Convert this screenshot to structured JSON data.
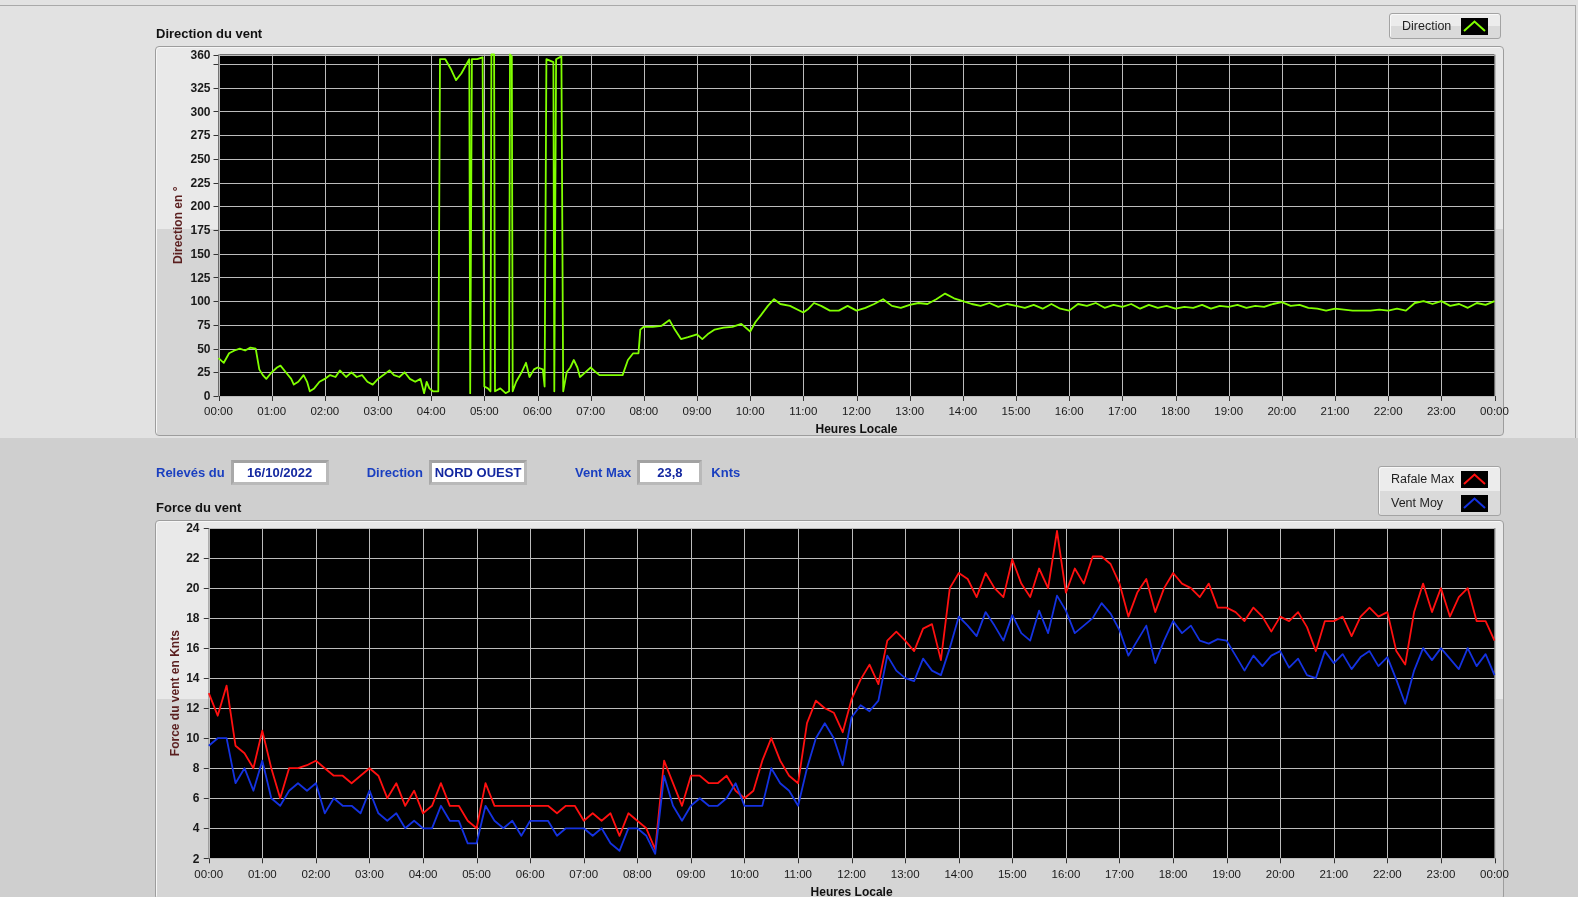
{
  "direction_chart": {
    "axis_end_label": "00:00",
    "chart_data": {
      "type": "line",
      "title": "Direction du vent",
      "xlabel": "Heures Locale",
      "ylabel": "Direction en °",
      "grid": true,
      "xlim": [
        0,
        1440
      ],
      "ylim": [
        0,
        360
      ],
      "xticks": [
        {
          "value": 0,
          "label": "00:00"
        },
        {
          "value": 60,
          "label": "01:00"
        },
        {
          "value": 120,
          "label": "02:00"
        },
        {
          "value": 180,
          "label": "03:00"
        },
        {
          "value": 240,
          "label": "04:00"
        },
        {
          "value": 300,
          "label": "05:00"
        },
        {
          "value": 360,
          "label": "06:00"
        },
        {
          "value": 420,
          "label": "07:00"
        },
        {
          "value": 480,
          "label": "08:00"
        },
        {
          "value": 540,
          "label": "09:00"
        },
        {
          "value": 600,
          "label": "10:00"
        },
        {
          "value": 660,
          "label": "11:00"
        },
        {
          "value": 720,
          "label": "12:00"
        },
        {
          "value": 780,
          "label": "13:00"
        },
        {
          "value": 840,
          "label": "14:00"
        },
        {
          "value": 900,
          "label": "15:00"
        },
        {
          "value": 960,
          "label": "16:00"
        },
        {
          "value": 1020,
          "label": "17:00"
        },
        {
          "value": 1080,
          "label": "18:00"
        },
        {
          "value": 1140,
          "label": "19:00"
        },
        {
          "value": 1200,
          "label": "20:00"
        },
        {
          "value": 1260,
          "label": "21:00"
        },
        {
          "value": 1320,
          "label": "22:00"
        },
        {
          "value": 1380,
          "label": "23:00"
        }
      ],
      "yticks": [
        0,
        25,
        50,
        75,
        100,
        125,
        150,
        175,
        200,
        225,
        250,
        275,
        300,
        325,
        360
      ],
      "x": [
        0,
        6,
        12,
        18,
        24,
        30,
        36,
        42,
        46,
        50,
        54,
        60,
        66,
        70,
        76,
        82,
        85,
        90,
        96,
        100,
        103,
        108,
        114,
        120,
        126,
        132,
        137,
        144,
        150,
        156,
        162,
        168,
        174,
        180,
        186,
        193,
        198,
        204,
        210,
        216,
        222,
        228,
        232,
        235,
        238,
        242,
        248,
        250,
        256,
        262,
        268,
        274,
        280,
        283,
        284,
        286,
        292,
        298,
        300,
        304,
        307,
        308,
        311,
        312,
        318,
        324,
        328,
        329,
        331,
        332,
        336,
        342,
        347,
        351,
        356,
        360,
        366,
        368,
        370,
        378,
        379,
        381,
        387,
        389,
        393,
        397,
        401,
        405,
        408,
        414,
        420,
        426,
        430,
        440,
        450,
        456,
        462,
        468,
        474,
        476,
        480,
        490,
        500,
        509,
        515,
        522,
        530,
        540,
        546,
        552,
        560,
        570,
        580,
        590,
        600,
        606,
        612,
        620,
        627,
        634,
        645,
        660,
        666,
        672,
        680,
        690,
        700,
        710,
        720,
        730,
        740,
        750,
        760,
        770,
        780,
        790,
        800,
        810,
        820,
        830,
        840,
        850,
        860,
        870,
        880,
        890,
        900,
        910,
        920,
        930,
        940,
        950,
        960,
        970,
        980,
        990,
        1000,
        1010,
        1020,
        1030,
        1040,
        1050,
        1060,
        1070,
        1080,
        1090,
        1100,
        1110,
        1120,
        1130,
        1140,
        1150,
        1160,
        1170,
        1180,
        1190,
        1200,
        1210,
        1220,
        1230,
        1240,
        1250,
        1260,
        1270,
        1280,
        1290,
        1300,
        1310,
        1320,
        1330,
        1340,
        1350,
        1360,
        1370,
        1380,
        1390,
        1400,
        1410,
        1420,
        1430,
        1440
      ],
      "series": [
        {
          "name": "Direction",
          "color": "#80ff00",
          "values": [
            40,
            35,
            45,
            48,
            50,
            48,
            51,
            50,
            28,
            22,
            18,
            25,
            30,
            32,
            25,
            18,
            12,
            15,
            22,
            15,
            5,
            8,
            15,
            18,
            22,
            20,
            27,
            20,
            25,
            20,
            22,
            15,
            12,
            18,
            22,
            27,
            22,
            20,
            25,
            18,
            15,
            18,
            3,
            15,
            8,
            5,
            5,
            355,
            355,
            345,
            333,
            340,
            350,
            355,
            3,
            355,
            355,
            357,
            10,
            8,
            5,
            360,
            360,
            5,
            8,
            3,
            5,
            360,
            358,
            5,
            15,
            25,
            35,
            20,
            28,
            30,
            28,
            10,
            355,
            352,
            5,
            355,
            358,
            5,
            25,
            30,
            38,
            30,
            20,
            25,
            30,
            25,
            22,
            22,
            22,
            22,
            38,
            45,
            45,
            70,
            73,
            73,
            74,
            80,
            70,
            60,
            62,
            65,
            60,
            65,
            70,
            72,
            73,
            76,
            68,
            78,
            85,
            95,
            102,
            97,
            95,
            88,
            92,
            98,
            95,
            90,
            90,
            95,
            90,
            93,
            97,
            102,
            95,
            93,
            96,
            98,
            97,
            102,
            108,
            103,
            100,
            97,
            95,
            98,
            94,
            97,
            95,
            93,
            96,
            92,
            97,
            92,
            90,
            97,
            95,
            98,
            93,
            96,
            94,
            97,
            92,
            96,
            93,
            95,
            92,
            94,
            93,
            96,
            92,
            95,
            94,
            96,
            93,
            95,
            94,
            97,
            99,
            95,
            96,
            93,
            92,
            90,
            92,
            91,
            90,
            90,
            90,
            91,
            90,
            92,
            90,
            98,
            100,
            97,
            100,
            95,
            97,
            93,
            98,
            96,
            100
          ]
        }
      ]
    }
  },
  "readings": [
    {
      "label": "Relevés du",
      "value": "16/10/2022"
    },
    {
      "label": "Direction",
      "value": "NORD OUEST"
    },
    {
      "label": "Vent Max",
      "value": "23,8",
      "unit": "Knts"
    }
  ],
  "force_chart": {
    "axis_end_label": "00:00",
    "chart_data": {
      "type": "line",
      "title": "Force du vent",
      "xlabel": "Heures Locale",
      "ylabel": "Force du vent en Knts",
      "grid": true,
      "xlim": [
        0,
        1440
      ],
      "ylim": [
        2,
        24
      ],
      "xticks": [
        {
          "value": 0,
          "label": "00:00"
        },
        {
          "value": 60,
          "label": "01:00"
        },
        {
          "value": 120,
          "label": "02:00"
        },
        {
          "value": 180,
          "label": "03:00"
        },
        {
          "value": 240,
          "label": "04:00"
        },
        {
          "value": 300,
          "label": "05:00"
        },
        {
          "value": 360,
          "label": "06:00"
        },
        {
          "value": 420,
          "label": "07:00"
        },
        {
          "value": 480,
          "label": "08:00"
        },
        {
          "value": 540,
          "label": "09:00"
        },
        {
          "value": 600,
          "label": "10:00"
        },
        {
          "value": 660,
          "label": "11:00"
        },
        {
          "value": 720,
          "label": "12:00"
        },
        {
          "value": 780,
          "label": "13:00"
        },
        {
          "value": 840,
          "label": "14:00"
        },
        {
          "value": 900,
          "label": "15:00"
        },
        {
          "value": 960,
          "label": "16:00"
        },
        {
          "value": 1020,
          "label": "17:00"
        },
        {
          "value": 1080,
          "label": "18:00"
        },
        {
          "value": 1140,
          "label": "19:00"
        },
        {
          "value": 1200,
          "label": "20:00"
        },
        {
          "value": 1260,
          "label": "21:00"
        },
        {
          "value": 1320,
          "label": "22:00"
        },
        {
          "value": 1380,
          "label": "23:00"
        }
      ],
      "yticks": [
        2,
        4,
        6,
        8,
        10,
        12,
        14,
        16,
        18,
        20,
        22,
        24
      ],
      "x": [
        0,
        10,
        20,
        30,
        40,
        50,
        60,
        70,
        80,
        90,
        100,
        110,
        120,
        130,
        140,
        150,
        160,
        170,
        180,
        190,
        200,
        210,
        220,
        230,
        240,
        250,
        260,
        270,
        280,
        290,
        300,
        310,
        320,
        330,
        340,
        350,
        360,
        370,
        380,
        390,
        400,
        410,
        420,
        430,
        440,
        450,
        460,
        470,
        480,
        490,
        500,
        510,
        520,
        530,
        540,
        550,
        560,
        570,
        580,
        590,
        600,
        610,
        620,
        630,
        640,
        650,
        660,
        670,
        680,
        690,
        700,
        710,
        720,
        730,
        740,
        750,
        760,
        770,
        780,
        790,
        800,
        810,
        820,
        830,
        840,
        850,
        860,
        870,
        880,
        890,
        900,
        910,
        920,
        930,
        940,
        950,
        960,
        970,
        980,
        990,
        1000,
        1010,
        1020,
        1030,
        1040,
        1050,
        1060,
        1070,
        1080,
        1090,
        1100,
        1110,
        1120,
        1130,
        1140,
        1150,
        1160,
        1170,
        1180,
        1190,
        1200,
        1210,
        1220,
        1230,
        1240,
        1250,
        1260,
        1270,
        1280,
        1290,
        1300,
        1310,
        1320,
        1330,
        1340,
        1350,
        1360,
        1370,
        1380,
        1390,
        1400,
        1410,
        1420,
        1430,
        1440
      ],
      "series": [
        {
          "name": "Rafale Max",
          "color": "#ff1010",
          "values": [
            13,
            11.5,
            13.5,
            9.5,
            9,
            8,
            10.5,
            8,
            6,
            8,
            8,
            8.2,
            8.5,
            8,
            7.5,
            7.5,
            7,
            7.5,
            8,
            7.5,
            6,
            7,
            5.5,
            6.5,
            5,
            5.5,
            7,
            5.5,
            5.5,
            4.5,
            4,
            7,
            5.5,
            5.5,
            5.5,
            5.5,
            5.5,
            5.5,
            5.5,
            5,
            5.5,
            5.5,
            4.5,
            5,
            4.5,
            5,
            3.5,
            5,
            4.5,
            4,
            2.6,
            8.5,
            7,
            5.5,
            7.5,
            7.5,
            7,
            7,
            7.5,
            6.5,
            6,
            6.5,
            8.5,
            10,
            8.5,
            7.5,
            7,
            11,
            12.5,
            12,
            11.7,
            10.4,
            12.6,
            13.9,
            14.9,
            13.6,
            16.5,
            17.1,
            16.5,
            15.8,
            17.3,
            17.6,
            15.2,
            20,
            21,
            20.6,
            19.4,
            21,
            20,
            19.4,
            21.9,
            20.3,
            19.4,
            21.3,
            20,
            23.8,
            19.7,
            21.3,
            20.3,
            22.1,
            22.1,
            21.6,
            20.3,
            18.1,
            19.7,
            20.6,
            18.4,
            20,
            21,
            20.3,
            20,
            19.4,
            20.3,
            18.7,
            18.7,
            18.4,
            17.8,
            18.7,
            18.1,
            17.1,
            18.1,
            17.8,
            18.4,
            17.4,
            15.8,
            17.8,
            17.8,
            18.1,
            16.8,
            18.1,
            18.7,
            18.1,
            18.4,
            15.8,
            14.9,
            18.4,
            20.3,
            18.4,
            20,
            18.1,
            19.4,
            20,
            17.8,
            17.8,
            16.5
          ]
        },
        {
          "name": "Vent Moy",
          "color": "#1432e0",
          "values": [
            9.5,
            10,
            10,
            7,
            8,
            6.5,
            8.5,
            6,
            5.5,
            6.5,
            7,
            6.5,
            7,
            5,
            6,
            5.5,
            5.5,
            5,
            6.5,
            5,
            4.5,
            5,
            4,
            4.5,
            4,
            4,
            5.5,
            4.5,
            4.5,
            3,
            3,
            5.5,
            4.5,
            4,
            4.5,
            3.5,
            4.5,
            4.5,
            4.5,
            3.5,
            4,
            4,
            4,
            3.5,
            4,
            3,
            2.5,
            4,
            4,
            3.5,
            2.3,
            7.5,
            5.5,
            4.5,
            5.5,
            6,
            5.5,
            5.5,
            6,
            7,
            5.5,
            5.5,
            5.5,
            8,
            7,
            6.5,
            5.5,
            8,
            10,
            11,
            10,
            8.2,
            11.4,
            12.2,
            11.8,
            12.5,
            15.5,
            14.5,
            14,
            13.8,
            15.3,
            14.5,
            14.2,
            16,
            18.1,
            17.5,
            16.8,
            18.4,
            17.5,
            16.5,
            18.2,
            17,
            16.5,
            18.5,
            17,
            19.5,
            18.5,
            17,
            17.5,
            18,
            19,
            18.3,
            17.2,
            15.5,
            16.5,
            17.5,
            15,
            16.5,
            17.8,
            17,
            17.5,
            16.5,
            16.3,
            16.6,
            16.5,
            15.5,
            14.5,
            15.5,
            14.8,
            15.5,
            15.8,
            14.7,
            15.3,
            14.2,
            14,
            15.8,
            15,
            15.6,
            14.6,
            15.4,
            15.8,
            14.8,
            15.4,
            13.9,
            12.3,
            14.5,
            16,
            15.2,
            16,
            15.3,
            14.6,
            16,
            14.8,
            15.6,
            14.2
          ]
        }
      ]
    }
  }
}
